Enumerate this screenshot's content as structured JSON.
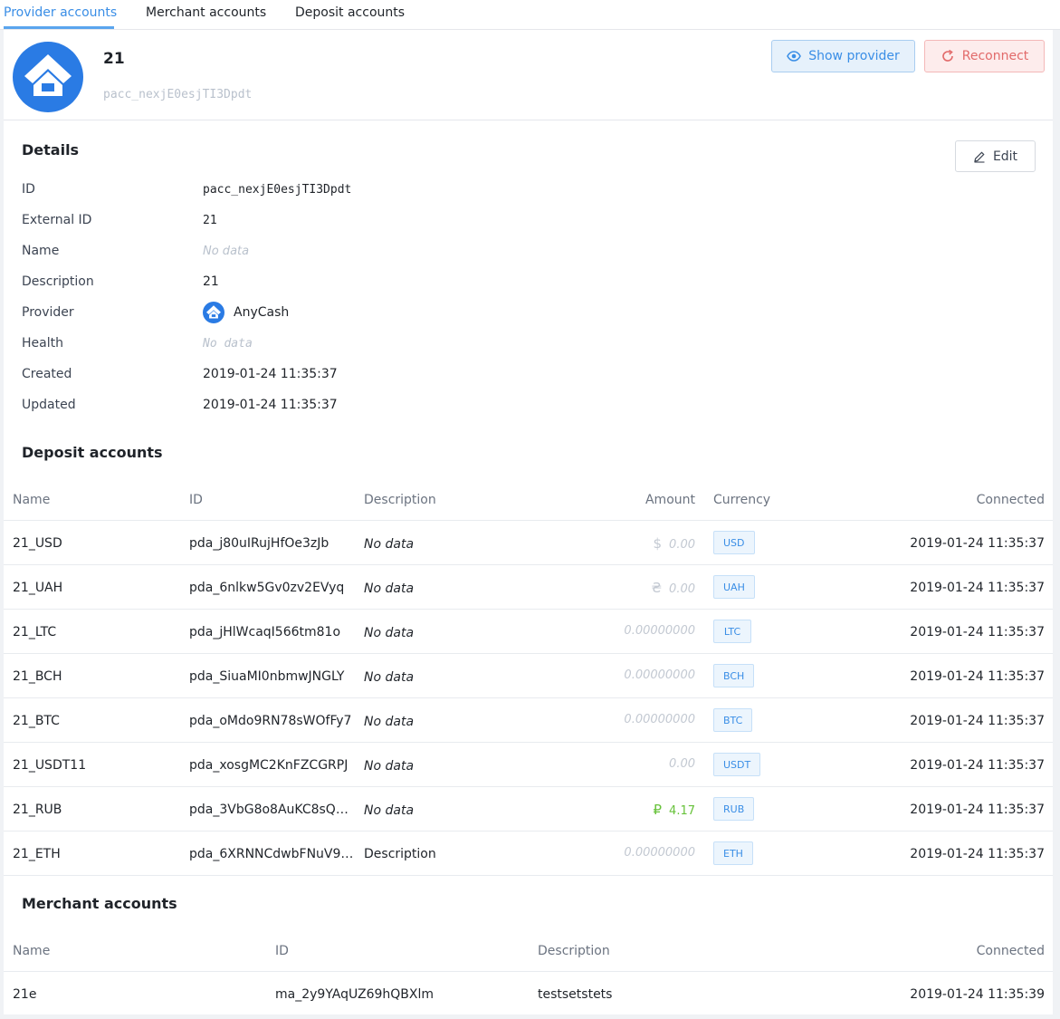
{
  "tabs": [
    {
      "label": "Provider accounts",
      "active": true
    },
    {
      "label": "Merchant accounts",
      "active": false
    },
    {
      "label": "Deposit accounts",
      "active": false
    }
  ],
  "header": {
    "title": "21",
    "subtitle": "pacc_nexjE0esjTI3Dpdt",
    "show_provider_label": "Show provider",
    "reconnect_label": "Reconnect"
  },
  "details": {
    "title": "Details",
    "edit_label": "Edit",
    "rows": [
      {
        "label": "ID",
        "value": "pacc_nexjE0esjTI3Dpdt"
      },
      {
        "label": "External ID",
        "value": "21"
      },
      {
        "label": "Name",
        "value": "No data"
      },
      {
        "label": "Description",
        "value": "21"
      },
      {
        "label": "Provider",
        "value": "AnyCash"
      },
      {
        "label": "Health",
        "value": "No data"
      },
      {
        "label": "Created",
        "value": "2019-01-24 11:35:37"
      },
      {
        "label": "Updated",
        "value": "2019-01-24 11:35:37"
      }
    ]
  },
  "deposit_accounts": {
    "title": "Deposit accounts",
    "columns": [
      "Name",
      "ID",
      "Description",
      "Amount",
      "Currency",
      "Connected"
    ],
    "rows": [
      {
        "name": "21_USD",
        "id": "pda_j80uIRujHfOe3zJb",
        "description": "No data",
        "amount": "0.00",
        "symbol": "$",
        "currency": "USD",
        "connected": "2019-01-24 11:35:37"
      },
      {
        "name": "21_UAH",
        "id": "pda_6nlkw5Gv0zv2EVyq",
        "description": "No data",
        "amount": "0.00",
        "symbol": "₴",
        "currency": "UAH",
        "connected": "2019-01-24 11:35:37"
      },
      {
        "name": "21_LTC",
        "id": "pda_jHlWcaqI566tm81o",
        "description": "No data",
        "amount": "0.00000000",
        "symbol": "",
        "currency": "LTC",
        "connected": "2019-01-24 11:35:37"
      },
      {
        "name": "21_BCH",
        "id": "pda_SiuaMI0nbmwJNGLY",
        "description": "No data",
        "amount": "0.00000000",
        "symbol": "",
        "currency": "BCH",
        "connected": "2019-01-24 11:35:37"
      },
      {
        "name": "21_BTC",
        "id": "pda_oMdo9RN78sWOfFy7",
        "description": "No data",
        "amount": "0.00000000",
        "symbol": "",
        "currency": "BTC",
        "connected": "2019-01-24 11:35:37"
      },
      {
        "name": "21_USDT11",
        "id": "pda_xosgMC2KnFZCGRPJ",
        "description": "No data",
        "amount": "0.00",
        "symbol": "",
        "currency": "USDT",
        "connected": "2019-01-24 11:35:37"
      },
      {
        "name": "21_RUB",
        "id": "pda_3VbG8o8AuKC8sQ…",
        "description": "No data",
        "amount": "4.17",
        "symbol": "₽",
        "currency": "RUB",
        "connected": "2019-01-24 11:35:37"
      },
      {
        "name": "21_ETH",
        "id": "pda_6XRNNCdwbFNuV9…",
        "description": "Description",
        "amount": "0.00000000",
        "symbol": "",
        "currency": "ETH",
        "connected": "2019-01-24 11:35:37"
      }
    ]
  },
  "merchant_accounts": {
    "title": "Merchant accounts",
    "columns": [
      "Name",
      "ID",
      "Description",
      "Connected"
    ],
    "rows": [
      {
        "name": "21e",
        "id": "ma_2y9YAqUZ69hQBXlm",
        "description": "testsetstets",
        "connected": "2019-01-24 11:35:39"
      }
    ]
  },
  "colors": {
    "accent": "#3a8ee6",
    "danger": "#e26a6a",
    "positive": "#67c23a",
    "muted": "#b9c1cc"
  }
}
